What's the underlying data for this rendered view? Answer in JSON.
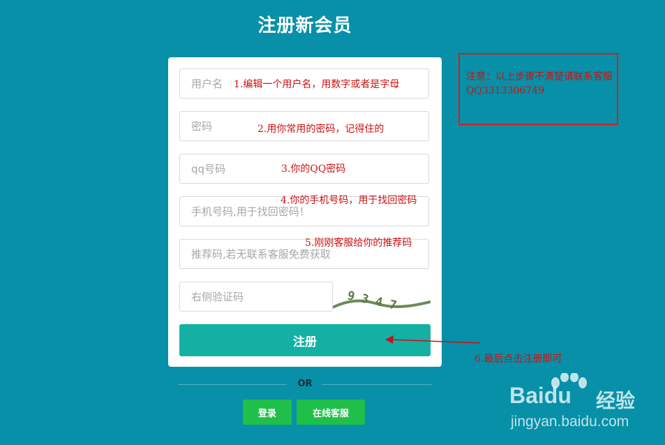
{
  "page_title": "注册新会员",
  "form": {
    "username_placeholder": "用户名",
    "password_placeholder": "密码",
    "qq_placeholder": "qq号码",
    "phone_placeholder": "手机号码,用于找回密码！",
    "referral_placeholder": "推荐码,若无联系客服免费获取",
    "captcha_placeholder": "右侧验证码",
    "captcha_code": "9 3  4 7",
    "register_label": "注册"
  },
  "or_label": "OR",
  "login_label": "登录",
  "online_service_label": "在线客服",
  "annotations": {
    "step1": "1.编辑一个用户名，用数字或者是字母",
    "step2": "2.用你常用的密码，记得住的",
    "step3": "3.你的QQ密码",
    "step4": "4.你的手机号码，用于找回密码",
    "step5": "5.刚刚客服给你的推荐码",
    "step6": "6.最后点击注册即可",
    "notice": "注意：以上步骤不清楚请联系客服 QQ3313306749"
  },
  "watermark": {
    "logo": "Baidu",
    "logo_cn": "经验",
    "url": "jingyan.baidu.com"
  },
  "colors": {
    "background": "#0790a8",
    "register_button": "#14b0a4",
    "green_buttons": "#1fbf4a",
    "annotation_red": "#cc1111"
  }
}
